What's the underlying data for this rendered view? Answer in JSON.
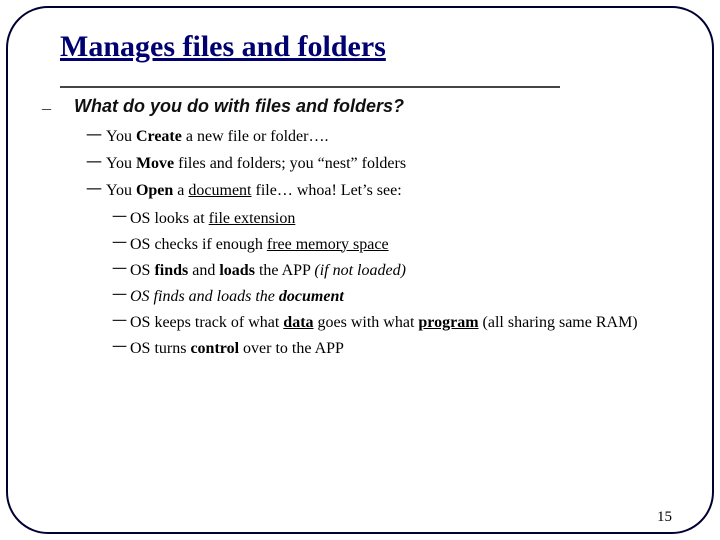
{
  "title": "Manages files and folders",
  "question": "What do you do with files and folders?",
  "items": {
    "a": {
      "pre": "You ",
      "key": "Create",
      "post": " a new file or folder…."
    },
    "b": {
      "pre": "You ",
      "key": "Move",
      "post": " files and folders; you “nest” folders"
    },
    "c": {
      "pre": "You ",
      "key": "Open",
      "mid": " a ",
      "doc": "document",
      "post": " file… whoa!   Let’s see:"
    }
  },
  "sub": {
    "s1": {
      "a": "OS looks at ",
      "u": "file extension"
    },
    "s2": {
      "a": "OS checks if enough  ",
      "u": "free memory space"
    },
    "s3": {
      "a": "OS ",
      "b": "finds",
      "c": " and ",
      "d": "loads",
      "e": " the APP  ",
      "f": "(if not loaded)"
    },
    "s4": {
      "a": "OS finds and loads the ",
      "b": "document"
    },
    "s5": {
      "a": "OS keeps track of what ",
      "u1": "data",
      "b": " goes with what ",
      "u2": "program",
      "c": " (all sharing same RAM)"
    },
    "s6": {
      "a": "OS turns ",
      "b": "control",
      "c": " over to the APP"
    }
  },
  "glyph": {
    "l1": "–",
    "l2": "一",
    "l3": "一"
  },
  "pagenum": "15"
}
